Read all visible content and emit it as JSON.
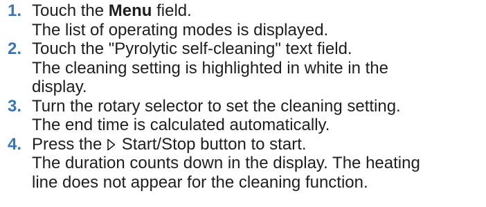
{
  "colors": {
    "accent": "#3a76b4",
    "text": "#1e1e1e"
  },
  "steps": [
    {
      "number": "1.",
      "action_prefix": "Touch the ",
      "action_bold": "Menu",
      "action_suffix": " field.",
      "result_lines": [
        "The list of operating modes is displayed."
      ]
    },
    {
      "number": "2.",
      "action": "Touch the \"Pyrolytic self-cleaning\" text field.",
      "result_lines": [
        "The cleaning setting is highlighted in white in the",
        "display."
      ]
    },
    {
      "number": "3.",
      "action": "Turn the rotary selector to set the cleaning setting.",
      "result_lines": [
        "The end time is calculated automatically."
      ]
    },
    {
      "number": "4.",
      "action_prefix": "Press the ",
      "action_icon": "start-stop-play-icon",
      "action_suffix": " Start/Stop button to start.",
      "result_lines": [
        "The duration counts down in the display. The heating",
        "line does not appear for the cleaning function."
      ]
    }
  ]
}
